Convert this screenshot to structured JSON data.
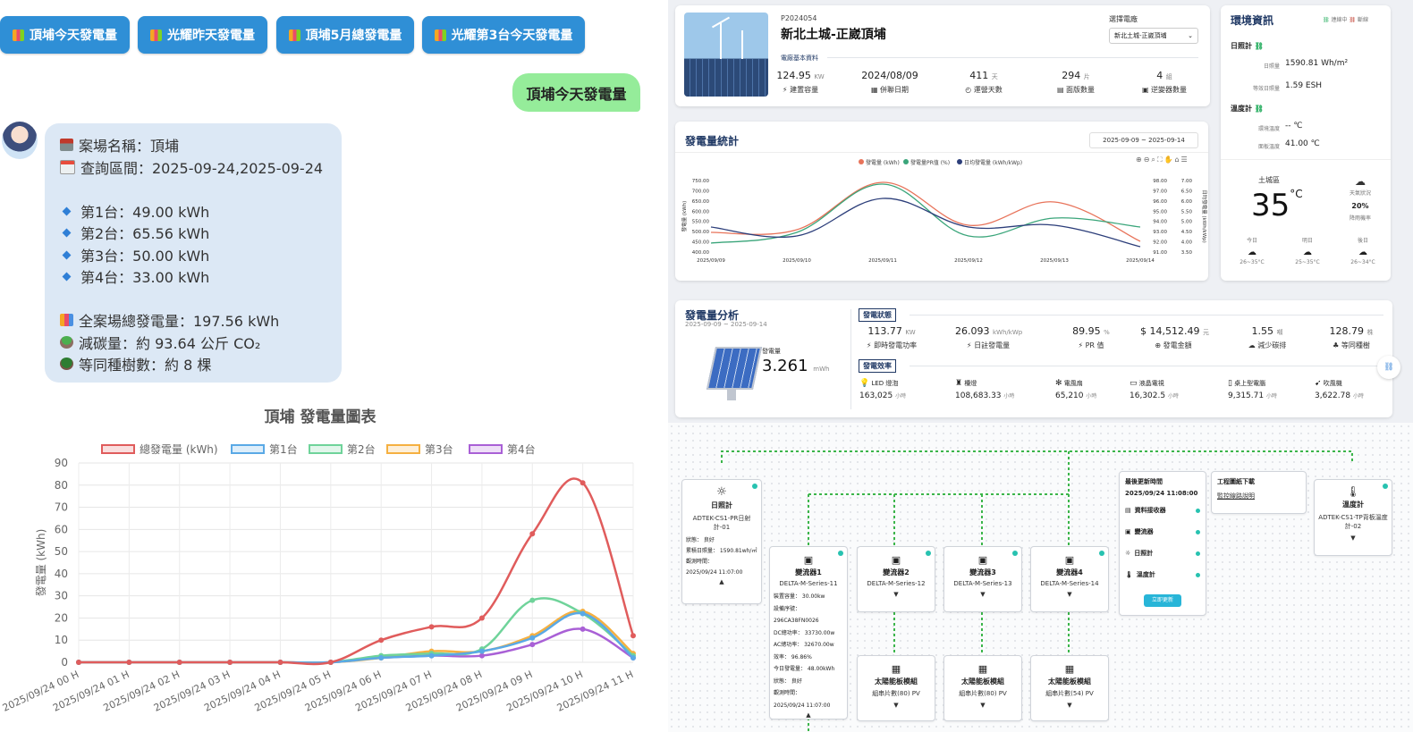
{
  "chat": {
    "quick_buttons": [
      "頂埔今天發電量",
      "光耀昨天發電量",
      "頂埔5月總發電量",
      "光耀第3台今天發電量"
    ],
    "user_message": "頂埔今天發電量",
    "bot": {
      "site_line": "案場名稱：頂埔",
      "range_line": "查詢區間：2025-09-24,2025-09-24",
      "units": [
        "第1台：49.00 kWh",
        "第2台：65.56 kWh",
        "第3台：50.00 kWh",
        "第4台：33.00 kWh"
      ],
      "total_line": "全案場總發電量：197.56 kWh",
      "carbon_line": "減碳量：約 93.64 公斤 CO₂",
      "trees_line": "等同種樹數：約 8 棵"
    }
  },
  "chart_data": {
    "type": "line",
    "title": "頂埔 發電量圖表",
    "ylabel": "發電量 (kWh)",
    "xlabel": "",
    "ylim": [
      0,
      90
    ],
    "yticks": [
      0,
      10,
      20,
      30,
      40,
      50,
      60,
      70,
      80,
      90
    ],
    "grid": true,
    "legend_position": "top",
    "x": [
      "2025/09/24 00 H",
      "2025/09/24 01 H",
      "2025/09/24 02 H",
      "2025/09/24 03 H",
      "2025/09/24 04 H",
      "2025/09/24 05 H",
      "2025/09/24 06 H",
      "2025/09/24 07 H",
      "2025/09/24 08 H",
      "2025/09/24 09 H",
      "2025/09/24 10 H",
      "2025/09/24 11 H"
    ],
    "series": [
      {
        "name": "總發電量 (kWh)",
        "color": "#e05c5c",
        "values": [
          0,
          0,
          0,
          0,
          0,
          0,
          10,
          16,
          20,
          58,
          81,
          12
        ]
      },
      {
        "name": "第1台",
        "color": "#5aa9e6",
        "values": [
          0,
          0,
          0,
          0,
          0,
          0,
          2,
          3,
          5,
          11,
          22,
          2
        ]
      },
      {
        "name": "第2台",
        "color": "#6fd39a",
        "values": [
          0,
          0,
          0,
          0,
          0,
          0,
          3,
          4,
          6,
          28,
          22,
          3
        ]
      },
      {
        "name": "第3台",
        "color": "#f5b041",
        "values": [
          0,
          0,
          0,
          0,
          0,
          0,
          2,
          5,
          5,
          12,
          23,
          4
        ]
      },
      {
        "name": "第4台",
        "color": "#a960d6",
        "values": [
          0,
          0,
          0,
          0,
          0,
          0,
          2,
          3,
          3,
          8,
          15,
          2
        ]
      }
    ]
  },
  "dashboard": {
    "site": {
      "code": "P2024054",
      "name": "新北土城-正崴頂埔",
      "select_label": "選擇電廠",
      "select_value": "新北土城-正崴頂埔",
      "section_label": "電廠基本資料",
      "stats": [
        {
          "value": "124.95",
          "unit": "KW",
          "label": "建置容量"
        },
        {
          "value": "2024/08/09",
          "unit": "",
          "label": "併聯日期"
        },
        {
          "value": "411",
          "unit": "天",
          "label": "運營天數"
        },
        {
          "value": "294",
          "unit": "片",
          "label": "面版數量"
        },
        {
          "value": "4",
          "unit": "組",
          "label": "逆變器數量"
        }
      ]
    },
    "stats_chart": {
      "title": "發電量統計",
      "date_range": "2025-09-09 ~ 2025-09-14",
      "legend": [
        "發電量 (kWh)",
        "發電量PR值 (%)",
        "日均發電量 (kWh/kWp)"
      ],
      "left_ticks": [
        "750.00",
        "700.00",
        "650.00",
        "600.00",
        "550.00",
        "500.00",
        "450.00",
        "400.00"
      ],
      "right_ticks_1": [
        "98.00",
        "97.00",
        "96.00",
        "95.00",
        "94.00",
        "93.00",
        "92.00",
        "91.00"
      ],
      "right_ticks_2": [
        "7.00",
        "6.50",
        "6.00",
        "5.50",
        "5.00",
        "4.50",
        "4.00",
        "3.50"
      ],
      "left_axis": "發電量 (kWh)",
      "right_axis": "日均發電量 (kWh/kWp)",
      "dates": [
        "2025/09/09",
        "2025/09/10",
        "2025/09/11",
        "2025/09/12",
        "2025/09/13",
        "2025/09/14"
      ]
    },
    "analysis": {
      "title": "發電量分析",
      "date_range": "2025-09-09 ~ 2025-09-14",
      "gen_label": "發電量",
      "gen_value": "3.261",
      "gen_unit": "mWh",
      "status_tag": "發電狀態",
      "efficiency_tag": "發電效率",
      "status": [
        {
          "value": "113.77",
          "unit": "KW",
          "label": "即時發電功率"
        },
        {
          "value": "26.093",
          "unit": "kWh/kWp",
          "label": "日註發電量"
        },
        {
          "value": "89.95",
          "unit": "%",
          "label": "PR 值"
        },
        {
          "value": "$ 14,512.49",
          "unit": "元",
          "label": "發電金額"
        },
        {
          "value": "1.55",
          "unit": "噸",
          "label": "減少碳排"
        },
        {
          "value": "128.79",
          "unit": "株",
          "label": "等同種樹"
        }
      ],
      "efficiency": [
        {
          "label": "LED 燈泡",
          "value": "163,025",
          "unit": "小時"
        },
        {
          "label": "檯燈",
          "value": "108,683.33",
          "unit": "小時"
        },
        {
          "label": "電風扇",
          "value": "65,210",
          "unit": "小時"
        },
        {
          "label": "液晶電視",
          "value": "16,302.5",
          "unit": "小時"
        },
        {
          "label": "桌上型電腦",
          "value": "9,315.71",
          "unit": "小時"
        },
        {
          "label": "吹風機",
          "value": "3,622.78",
          "unit": "小時"
        }
      ]
    },
    "env": {
      "title": "環境資訊",
      "connected": "連線中",
      "disconnected": "斷線",
      "irradiance_title": "日照計",
      "irradiance_label": "日照量",
      "irradiance_value": "1590.81 Wh/m²",
      "esh_label": "等效日照量",
      "esh_value": "1.59 ESH",
      "temp_title": "溫度計",
      "ambient_label": "環境溫度",
      "ambient_value": "-- ℃",
      "panel_label": "面板溫度",
      "panel_value": "41.00 ℃",
      "district": "土城區",
      "temperature": "35",
      "temp_unit": "°C",
      "weather_label": "天氣狀況",
      "rain_value": "20%",
      "rain_label": "降雨機率",
      "forecast": [
        {
          "day": "今日",
          "range": "26~35°C"
        },
        {
          "day": "明日",
          "range": "25~35°C"
        },
        {
          "day": "後日",
          "range": "26~34°C"
        }
      ]
    }
  },
  "diagram": {
    "irradiance": {
      "title": "日照計",
      "model": "ADTEK-CS1-PR日射計-01",
      "status": "狀態： 良好",
      "acc": "累積日照量： 1590.81wh/㎡",
      "time_label": "觀測時間：",
      "time": "2025/09/24 11:07:00"
    },
    "inverters": [
      {
        "title": "變流器1",
        "model": "DELTA-M-Series-11"
      },
      {
        "title": "變流器2",
        "model": "DELTA-M-Series-12"
      },
      {
        "title": "變流器3",
        "model": "DELTA-M-Series-13"
      },
      {
        "title": "變流器4",
        "model": "DELTA-M-Series-14"
      }
    ],
    "inverter1_detail": [
      "裝置容量： 30.00kw",
      "設備序號： 296CA38FN0026",
      "DC總功率： 33730.00w",
      "AC總功率： 32670.00w",
      "效率： 96.86%",
      "今日發電量： 48.00kWh",
      "狀態： 良好",
      "觀測時間：",
      "2025/09/24 11:07:00"
    ],
    "panels": [
      {
        "title": "太陽能板模組",
        "sub": "組串片數(80) PV"
      },
      {
        "title": "太陽能板模組",
        "sub": "組串片數(80) PV"
      },
      {
        "title": "太陽能板模組",
        "sub": "組串片數(54) PV"
      }
    ],
    "update": {
      "title": "最後更新時間",
      "time": "2025/09/24 11:08:00",
      "items": [
        "資料接收器",
        "變流器",
        "日照計",
        "溫度計"
      ],
      "button": "立即更新"
    },
    "drawing": {
      "title": "工程圖紙下載",
      "link": "監控線路說明"
    },
    "temp": {
      "title": "溫度計",
      "model": "ADTEK-CS1-TP背板溫度計-02"
    }
  }
}
